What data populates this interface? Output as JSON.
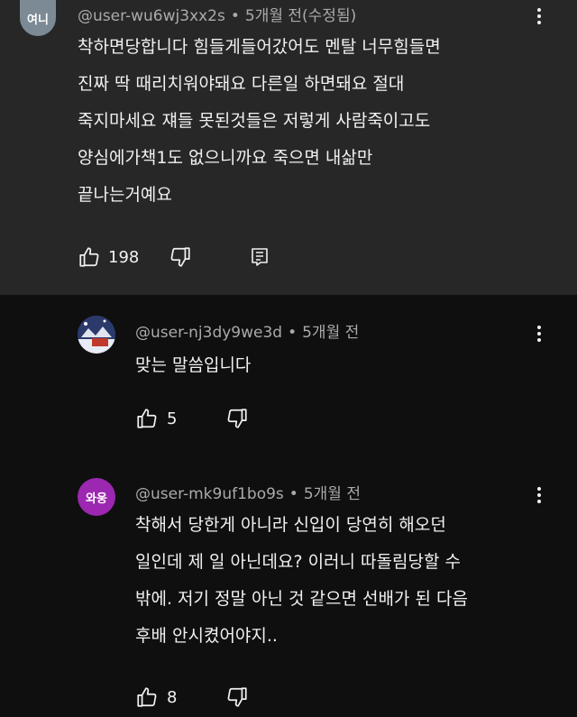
{
  "comments": [
    {
      "avatar_text": "여니",
      "avatar_color": "#7b8a95",
      "username": "@user-wu6wj3xx2s",
      "time": "5개월 전(수정됨)",
      "lines": [
        "착하면당합니다 힘들게들어갔어도 멘탈 너무힘들면",
        "진짜 딱 때리치워야돼요 다른일 하면돼요 절대",
        "죽지마세요 쟤들 못된것들은 저렇게 사람죽이고도",
        "양심에가책1도 없으니까요 죽으면 내삶만",
        "끝나는거예요"
      ],
      "likes": "198"
    },
    {
      "avatar_text": "",
      "avatar_color": "#3a4a7a",
      "username": "@user-nj3dy9we3d",
      "time": "5개월 전",
      "lines": [
        "맞는 말씀입니다"
      ],
      "likes": "5"
    },
    {
      "avatar_text": "와웅",
      "avatar_color": "#9c27b0",
      "username": "@user-mk9uf1bo9s",
      "time": "5개월 전",
      "lines": [
        "착해서 당한게 아니라 신입이 당연히 해오던",
        "일인데 제 일 아닌데요? 이러니 따돌림당할 수",
        "밖에. 저기 정말 아닌 것 같으면 선배가 된 다음",
        "후배 안시켰어야지.."
      ],
      "likes": "8"
    }
  ],
  "separator": "•"
}
